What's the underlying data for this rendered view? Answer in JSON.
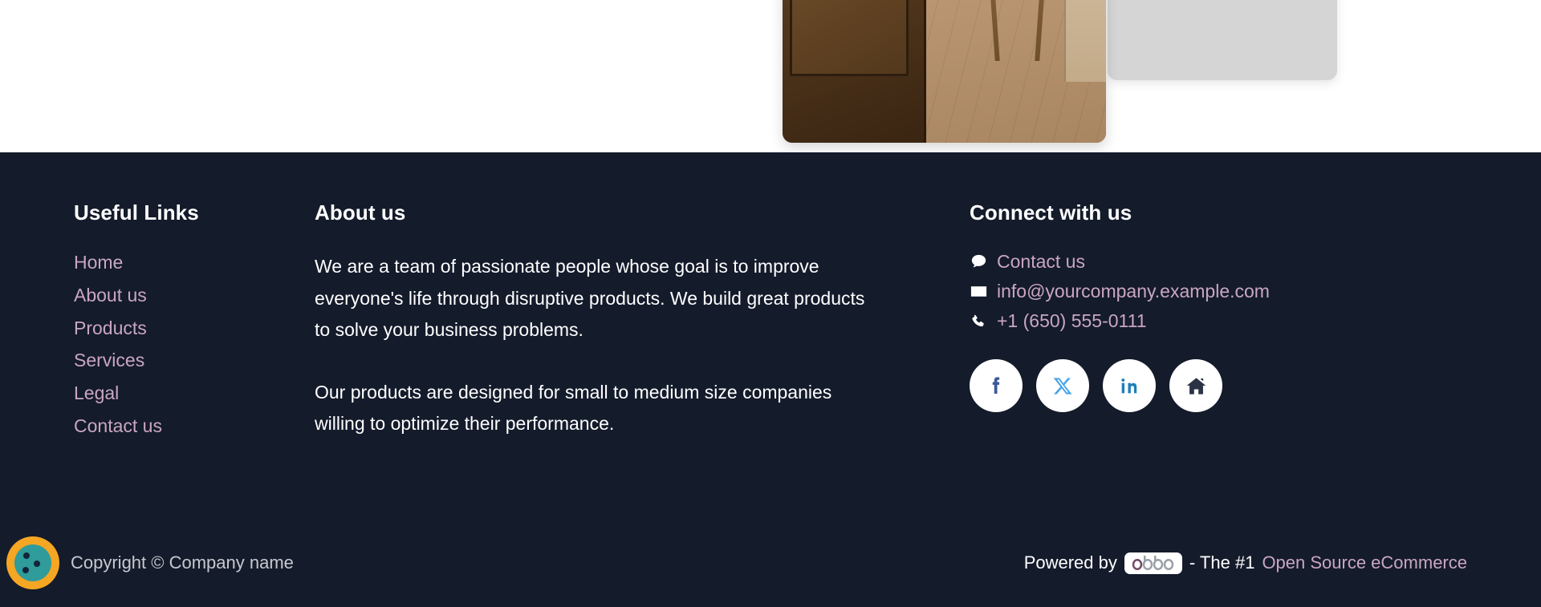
{
  "page": {
    "hero": {
      "photo_alt": "interior-room-photo",
      "placeholder_card": "gray-placeholder-card"
    }
  },
  "footer": {
    "background_color": "#141b2b",
    "link_color": "#c9a6c0",
    "text_color": "#ffffff",
    "columns": {
      "useful_links": {
        "heading": "Useful Links",
        "items": [
          {
            "label": "Home"
          },
          {
            "label": "About us"
          },
          {
            "label": "Products"
          },
          {
            "label": "Services"
          },
          {
            "label": "Legal"
          },
          {
            "label": "Contact us"
          }
        ]
      },
      "about": {
        "heading": "About us",
        "paragraphs": [
          "We are a team of passionate people whose goal is to improve everyone's life through disruptive products. We build great products to solve your business problems.",
          "Our products are designed for small to medium size companies willing to optimize their performance."
        ]
      },
      "connect": {
        "heading": "Connect with us",
        "contacts": [
          {
            "icon": "comment-icon",
            "label": "Contact us"
          },
          {
            "icon": "envelope-icon",
            "label": "info@yourcompany.example.com"
          },
          {
            "icon": "phone-icon",
            "label": "+1 (650) 555-0111"
          }
        ],
        "socials": [
          {
            "icon": "facebook-icon",
            "name": "Facebook",
            "color": "#3b5998"
          },
          {
            "icon": "x-twitter-icon",
            "name": "X",
            "color": "#4aa3e8"
          },
          {
            "icon": "linkedin-icon",
            "name": "LinkedIn",
            "color": "#1c7fb8"
          },
          {
            "icon": "home-icon",
            "name": "Home",
            "color": "#2a3244"
          }
        ]
      }
    },
    "bottom": {
      "logo": {
        "icon": "company-logo-icon",
        "ring_color": "#f5a623",
        "center_color": "#2f9b9b"
      },
      "copyright": "Copyright © Company name",
      "powered_prefix": "Powered by",
      "powered_brand": "odoo",
      "powered_middle": "- The #1",
      "powered_link": "Open Source eCommerce"
    }
  }
}
